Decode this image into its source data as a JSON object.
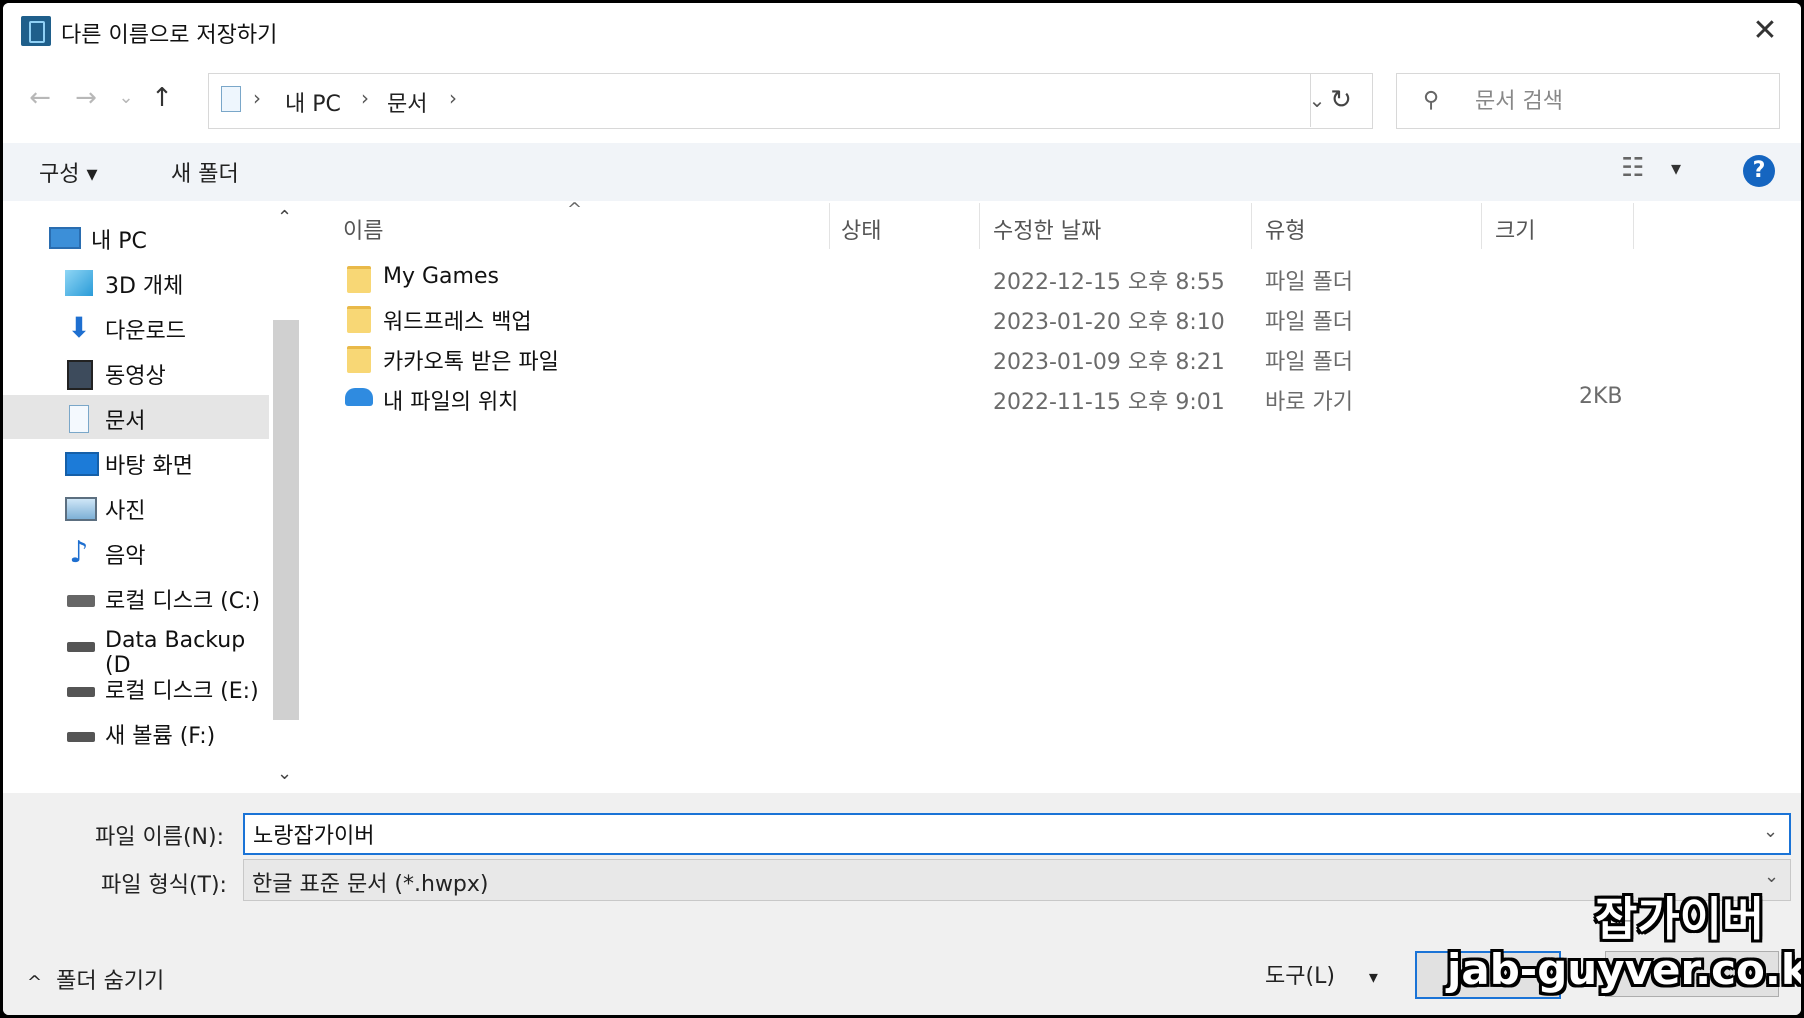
{
  "window": {
    "title": "다른 이름으로 저장하기",
    "close_glyph": "✕"
  },
  "nav": {
    "back_glyph": "←",
    "forward_glyph": "→",
    "recent_glyph": "⌄",
    "up_glyph": "↑",
    "breadcrumb": [
      "내 PC",
      "문서"
    ],
    "separator": "›",
    "dropdown_glyph": "⌄",
    "refresh_glyph": "↻"
  },
  "search": {
    "placeholder": "문서 검색",
    "icon_glyph": "⚲"
  },
  "toolbar": {
    "organize_label": "구성 ▾",
    "new_folder_label": "새 폴더",
    "view_glyph": "☷",
    "view_dd_glyph": "▾",
    "help_glyph": "?"
  },
  "sidebar": {
    "items": [
      {
        "label": "내 PC",
        "icon": "pc-icon"
      },
      {
        "label": "3D 개체",
        "icon": "cube-icon"
      },
      {
        "label": "다운로드",
        "icon": "download-icon"
      },
      {
        "label": "동영상",
        "icon": "video-icon"
      },
      {
        "label": "문서",
        "icon": "document-icon"
      },
      {
        "label": "바탕 화면",
        "icon": "desktop-icon"
      },
      {
        "label": "사진",
        "icon": "picture-icon"
      },
      {
        "label": "음악",
        "icon": "music-icon"
      },
      {
        "label": "로컬 디스크 (C:)",
        "icon": "drive-c-icon"
      },
      {
        "label": "Data Backup (D",
        "icon": "drive-icon"
      },
      {
        "label": "로컬 디스크 (E:)",
        "icon": "drive-icon"
      },
      {
        "label": "새 볼륨 (F:)",
        "icon": "drive-icon"
      }
    ],
    "selected_index": 4,
    "scroll_up": "⌃",
    "scroll_down": "⌄"
  },
  "file_list": {
    "sort_glyph": "^",
    "columns": [
      "이름",
      "상태",
      "수정한 날짜",
      "유형",
      "크기"
    ],
    "rows": [
      {
        "name": "My Games",
        "status": "",
        "date": "2022-12-15 오후 8:55",
        "type": "파일 폴더",
        "size": "",
        "icon": "folder-icon"
      },
      {
        "name": "워드프레스 백업",
        "status": "",
        "date": "2023-01-20 오후 8:10",
        "type": "파일 폴더",
        "size": "",
        "icon": "folder-icon"
      },
      {
        "name": "카카오톡 받은 파일",
        "status": "",
        "date": "2023-01-09 오후 8:21",
        "type": "파일 폴더",
        "size": "",
        "icon": "folder-icon"
      },
      {
        "name": "내 파일의 위치",
        "status": "",
        "date": "2022-11-15 오후 9:01",
        "type": "바로 가기",
        "size": "2KB",
        "icon": "cloud-shortcut-icon"
      }
    ]
  },
  "footer": {
    "filename_label": "파일 이름(N):",
    "filename_value": "노랑잡가이버",
    "filetype_label": "파일 형식(T):",
    "filetype_value": "한글 표준 문서 (*.hwpx)",
    "hide_folders_label": "폴더 숨기기",
    "hide_folders_glyph": "^",
    "tools_label": "도구(L)",
    "tools_dd_glyph": "▾",
    "dd_glyph": "⌄"
  },
  "watermark": {
    "line1": "잡가이버",
    "line2": "jab-guyver.co.kr"
  },
  "colors": {
    "accent": "#1a73d6",
    "help_blue": "#1565c0",
    "selected_bg": "#e5e5e5",
    "folder": "#f8d775"
  }
}
